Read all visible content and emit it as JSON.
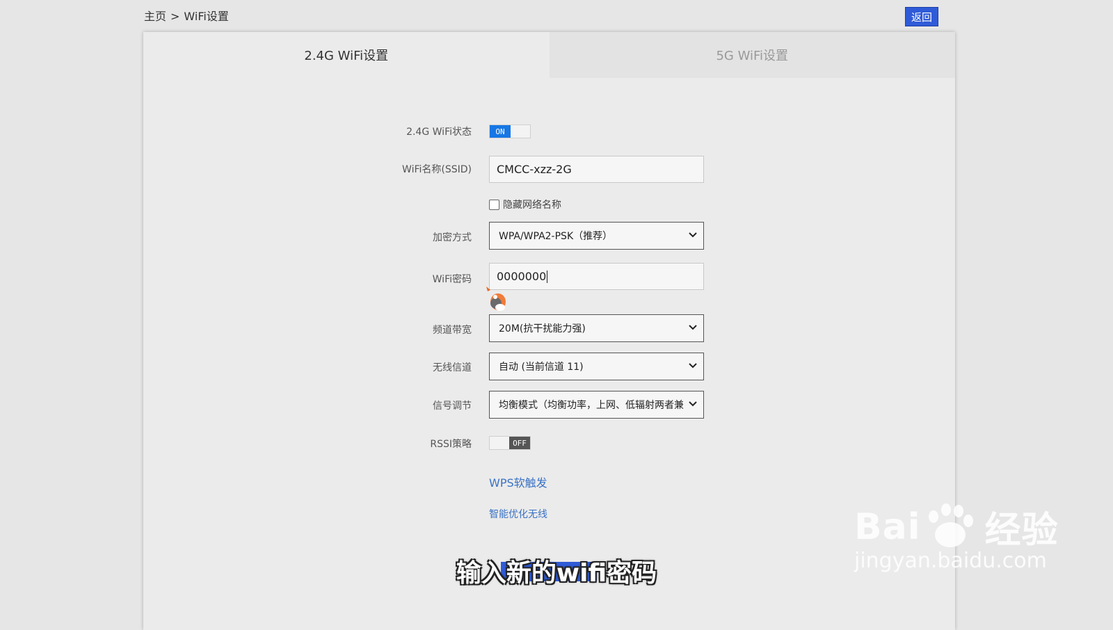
{
  "breadcrumb": {
    "home": "主页",
    "separator": ">",
    "current": "WiFi设置"
  },
  "header": {
    "back_label": "返回"
  },
  "tabs": [
    {
      "label": "2.4G WiFi设置",
      "active": true
    },
    {
      "label": "5G WiFi设置",
      "active": false
    }
  ],
  "form": {
    "wifi_status": {
      "label": "2.4G WiFi状态",
      "toggle_text": "ON",
      "on": true
    },
    "ssid": {
      "label": "WiFi名称(SSID)",
      "value": "CMCC-xzz-2G"
    },
    "hide_ssid": {
      "label": "隐藏网络名称",
      "checked": false
    },
    "encryption": {
      "label": "加密方式",
      "selected": "WPA/WPA2-PSK（推荐）"
    },
    "password": {
      "label": "WiFi密码",
      "value": "0000000"
    },
    "bandwidth": {
      "label": "频道带宽",
      "selected": "20M(抗干扰能力强)"
    },
    "channel": {
      "label": "无线信道",
      "selected": "自动 (当前信道 11)"
    },
    "signal": {
      "label": "信号调节",
      "selected": "均衡模式（均衡功率，上网、低辐射两者兼"
    },
    "rssi": {
      "label": "RSSI策略",
      "toggle_text": "OFF",
      "on": false
    },
    "wps_link": "WPS软触发",
    "optimize_link": "智能优化无线"
  },
  "overlay": {
    "subtitle": "输入新的wifi密码"
  },
  "watermark": {
    "brand": "Bai",
    "brand_suffix": "经验",
    "url": "jingyan.baidu.com"
  },
  "colors": {
    "accent": "#2f5bd8",
    "toggle_on": "#1677e5",
    "link": "#3a72c4"
  },
  "icons": {
    "select_arrow": "chevron-down-icon",
    "cursor": "mascot-cursor-icon"
  }
}
